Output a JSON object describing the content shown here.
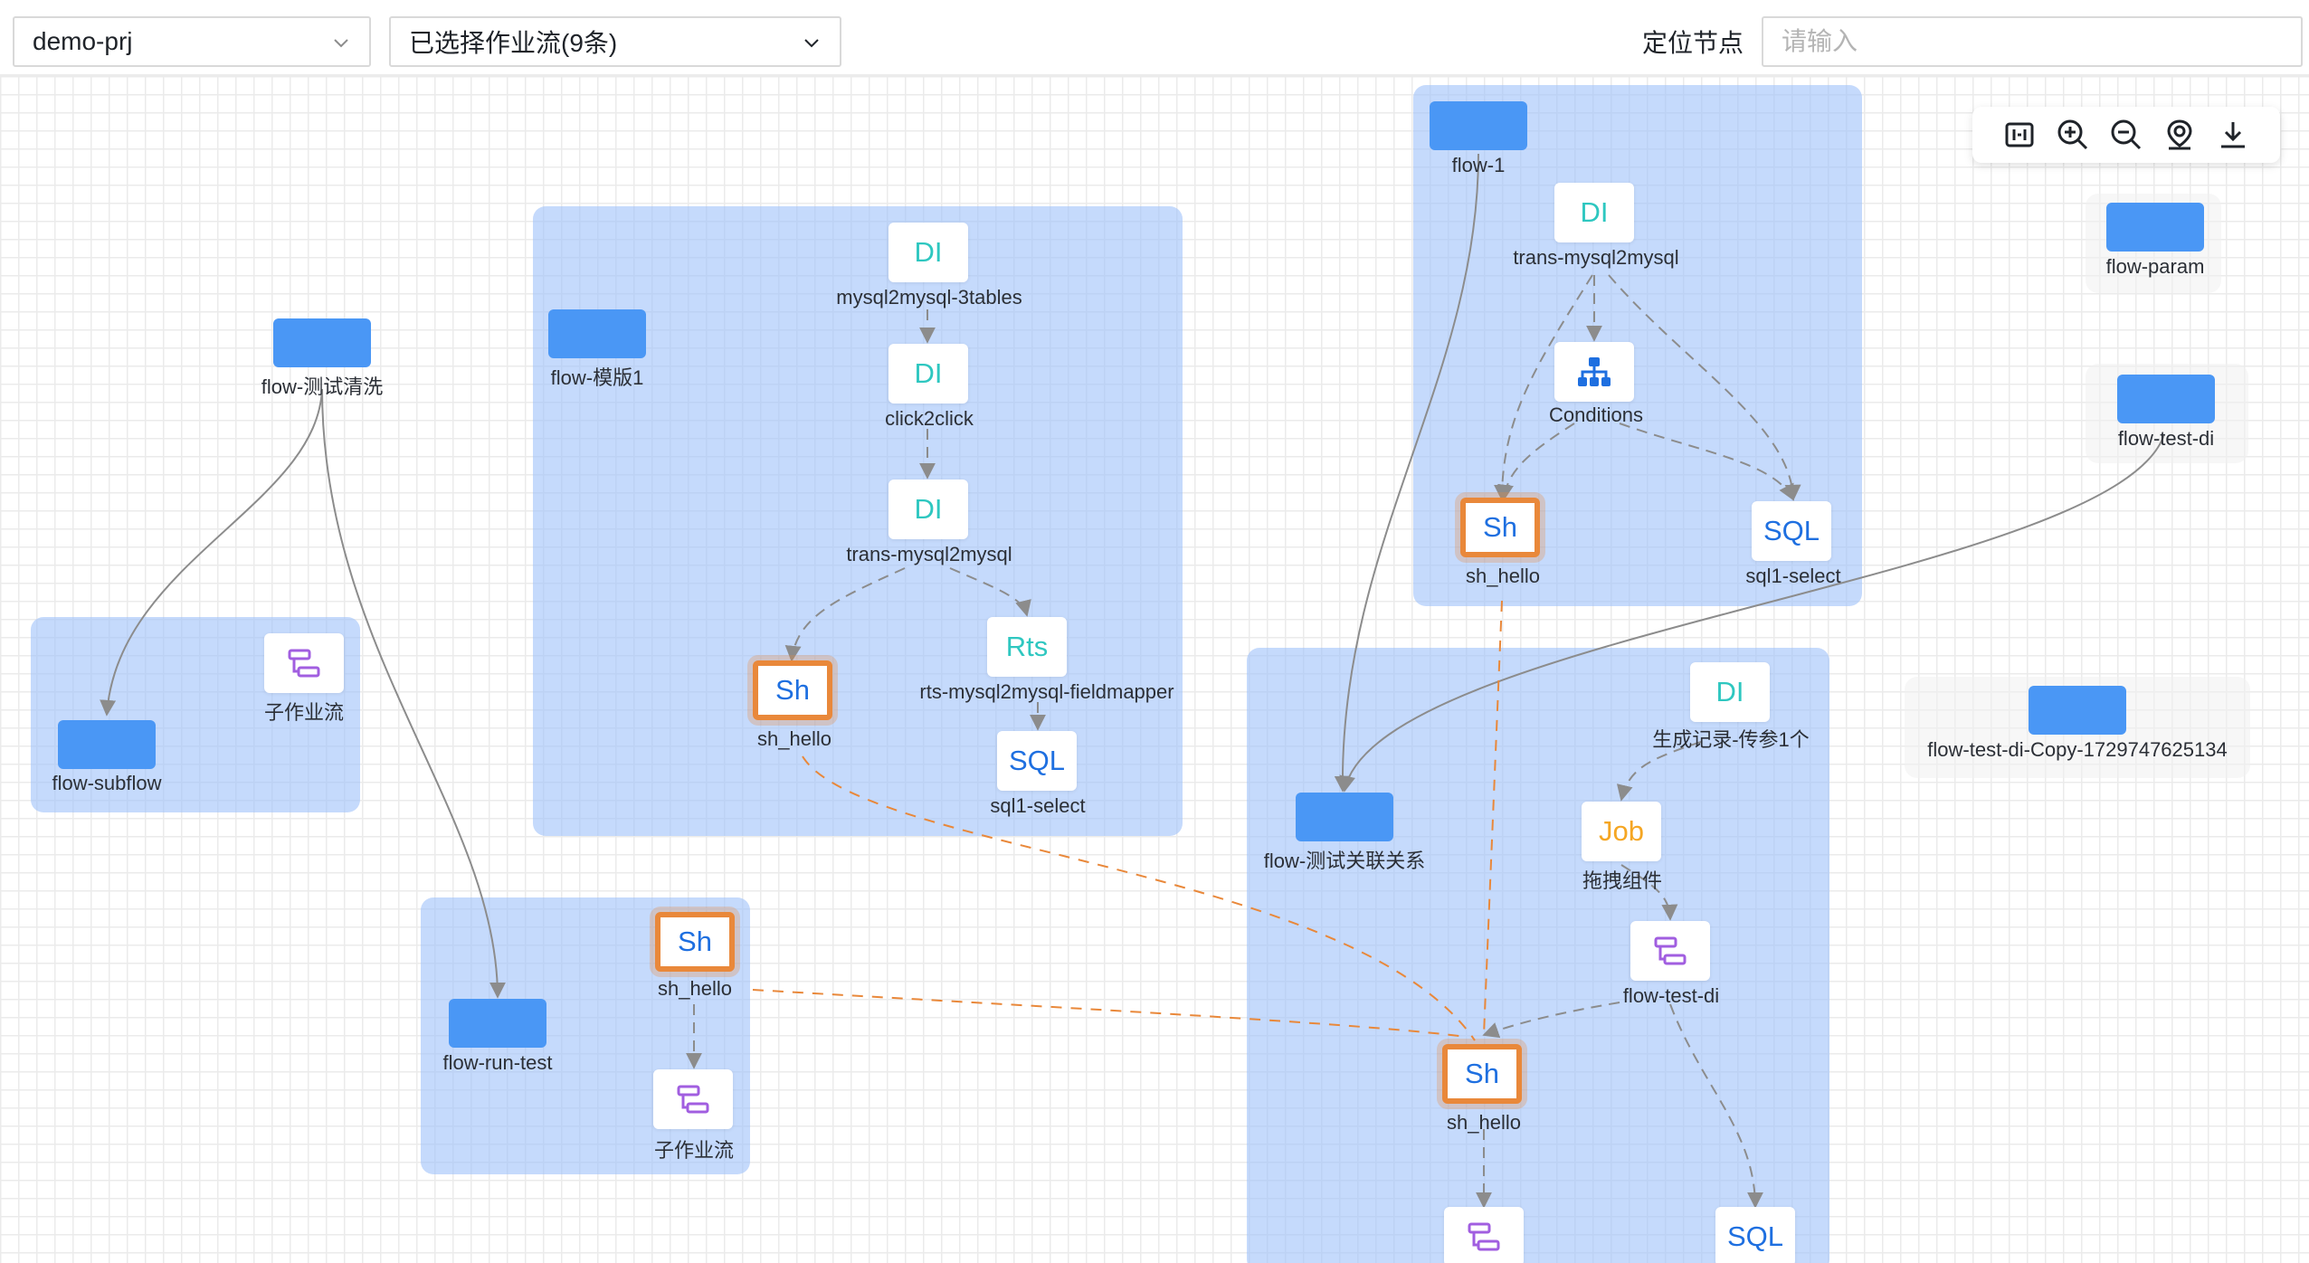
{
  "header": {
    "project_select": "demo-prj",
    "flow_select": "已选择作业流(9条)",
    "locate_label": "定位节点",
    "locate_placeholder": "请输入"
  },
  "toolbar": {
    "icons": [
      "fit-view-icon",
      "zoom-in-icon",
      "zoom-out-icon",
      "locate-icon",
      "download-icon"
    ]
  },
  "flows": {
    "flow_clean": "flow-测试清洗",
    "flow_subflow": "flow-subflow",
    "flow_template": "flow-模版1",
    "flow_run_test": "flow-run-test",
    "flow_1": "flow-1",
    "flow_param": "flow-param",
    "flow_test_di": "flow-test-di",
    "flow_relation": "flow-测试关联关系",
    "flow_test_di_copy": "flow-test-di-Copy-1729747625134"
  },
  "nodes": {
    "subflow_a_label": "子作业流",
    "n_mysql3": {
      "type": "DI",
      "label": "mysql2mysql-3tables"
    },
    "n_click": {
      "type": "DI",
      "label": "click2click"
    },
    "n_trans_a": {
      "type": "DI",
      "label": "trans-mysql2mysql"
    },
    "n_sh_a": {
      "type": "Sh",
      "label": "sh_hello"
    },
    "n_rts": {
      "type": "Rts",
      "label": "rts-mysql2mysql-fieldmapper"
    },
    "n_sql_a": {
      "type": "SQL",
      "label": "sql1-select"
    },
    "n_sh_b": {
      "type": "Sh",
      "label": "sh_hello"
    },
    "subflow_b_label": "子作业流",
    "n_trans_b": {
      "type": "DI",
      "label": "trans-mysql2mysql"
    },
    "n_cond": {
      "label": "Conditions"
    },
    "n_sh_c": {
      "type": "Sh",
      "label": "sh_hello"
    },
    "n_sql_b": {
      "type": "SQL",
      "label": "sql1-select"
    },
    "n_gen": {
      "type": "DI",
      "label": "生成记录-传参1个"
    },
    "n_job": {
      "type": "Job",
      "label": "拖拽组件"
    },
    "n_ftd": {
      "label": "flow-test-di"
    },
    "n_sh_d": {
      "type": "Sh",
      "label": "sh_hello"
    },
    "n_sql_c": {
      "type": "SQL"
    }
  },
  "colors": {
    "group_fill": "#a1c4fa",
    "flow_box": "#4a97f5",
    "highlight": "#e9883a",
    "di_text": "#2ec7c0",
    "sh_text": "#1e6fe0",
    "job_text": "#f5a623",
    "subflow_icon": "#a15ee0"
  }
}
